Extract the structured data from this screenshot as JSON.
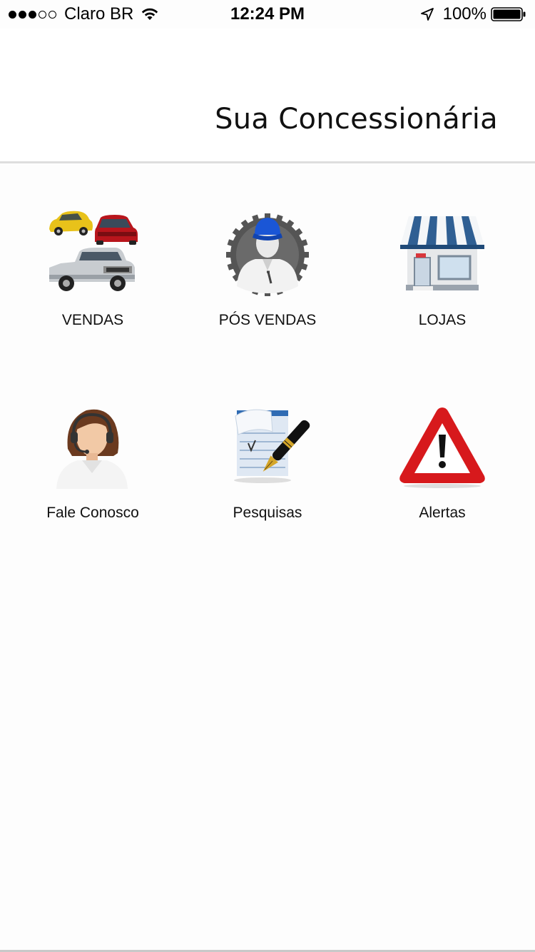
{
  "status_bar": {
    "signal_dots_full": 3,
    "signal_dots_empty": 2,
    "carrier": "Claro BR",
    "wifi_icon": "wifi-icon",
    "time": "12:24 PM",
    "location_icon": "location-arrow-icon",
    "battery_percent": "100%",
    "battery_level": 1.0,
    "battery_icon": "battery-icon"
  },
  "header": {
    "title": "Sua Concessionária"
  },
  "menu": {
    "items": [
      {
        "label": "VENDAS",
        "icon": "cars-icon"
      },
      {
        "label": "PÓS VENDAS",
        "icon": "mechanic-gear-icon"
      },
      {
        "label": "LOJAS",
        "icon": "storefront-icon"
      },
      {
        "label": "Fale Conosco",
        "icon": "headset-agent-icon"
      },
      {
        "label": "Pesquisas",
        "icon": "notepad-pen-icon"
      },
      {
        "label": "Alertas",
        "icon": "warning-triangle-icon"
      }
    ]
  },
  "colors": {
    "divider": "#dedede",
    "alert_red": "#d7191c",
    "awning_blue": "#2f5f93",
    "cap_blue": "#1a56d6"
  }
}
